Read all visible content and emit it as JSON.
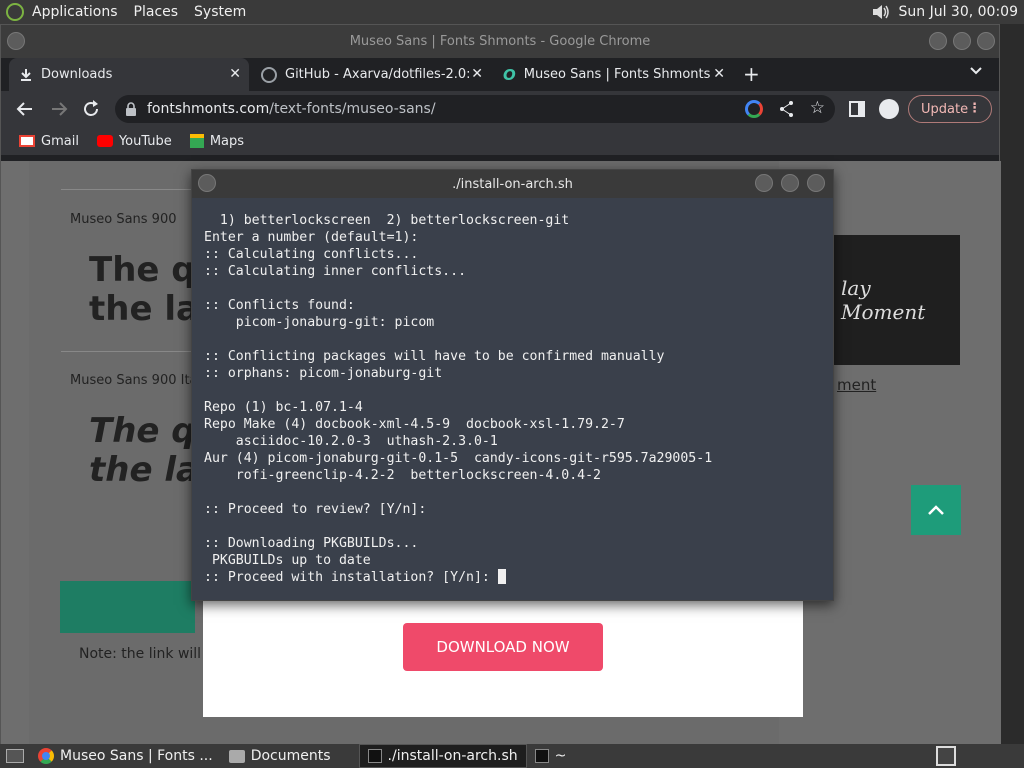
{
  "top_panel": {
    "menus": [
      "Applications",
      "Places",
      "System"
    ],
    "clock": "Sun Jul 30, 00:09"
  },
  "chrome": {
    "window_title": "Museo Sans | Fonts Shmonts - Google Chrome",
    "tabs": [
      {
        "label": "Downloads",
        "icon": "download-icon"
      },
      {
        "label": "GitHub - Axarva/dotfiles-2.0:",
        "icon": "github-icon"
      },
      {
        "label": "Museo Sans | Fonts Shmonts",
        "icon": "opera-o-icon"
      }
    ],
    "url_domain": "fontshmonts.com",
    "url_path": "/text-fonts/museo-sans/",
    "update_label": "Update",
    "bookmarks": [
      {
        "label": "Gmail",
        "icon": "gmail-icon"
      },
      {
        "label": "YouTube",
        "icon": "youtube-icon"
      },
      {
        "label": "Maps",
        "icon": "maps-icon"
      }
    ]
  },
  "page": {
    "font_label_1": "Museo Sans 900",
    "sample_line_1a": "The qu",
    "sample_line_1b": "the laz",
    "font_label_2": "Museo Sans 900 Italic",
    "sample_line_2a": "The qu",
    "sample_line_2b": "the laz",
    "ad_text": "lay Moment",
    "ad_link": "ment",
    "download_button": "DOWNLOAD NOW",
    "note": "Note: the link will e"
  },
  "terminal": {
    "title": "./install-on-arch.sh",
    "lines": [
      "  1) betterlockscreen  2) betterlockscreen-git",
      "Enter a number (default=1):",
      ":: Calculating conflicts...",
      ":: Calculating inner conflicts...",
      "",
      ":: Conflicts found:",
      "    picom-jonaburg-git: picom",
      "",
      ":: Conflicting packages will have to be confirmed manually",
      ":: orphans: picom-jonaburg-git",
      "",
      "Repo (1) bc-1.07.1-4",
      "Repo Make (4) docbook-xml-4.5-9  docbook-xsl-1.79.2-7",
      "    asciidoc-10.2.0-3  uthash-2.3.0-1",
      "Aur (4) picom-jonaburg-git-0.1-5  candy-icons-git-r595.7a29005-1",
      "    rofi-greenclip-4.2-2  betterlockscreen-4.0.4-2",
      "",
      ":: Proceed to review? [Y/n]:",
      "",
      ":: Downloading PKGBUILDs...",
      " PKGBUILDs up to date",
      ":: Proceed with installation? [Y/n]: "
    ]
  },
  "taskbar": {
    "tasks": [
      {
        "label": "Museo Sans | Fonts ...",
        "icon": "chrome-icon"
      },
      {
        "label": "Documents",
        "icon": "folder-icon"
      },
      {
        "label": "./install-on-arch.sh",
        "icon": "terminal-icon"
      },
      {
        "label": "~",
        "icon": "terminal-icon"
      }
    ]
  }
}
